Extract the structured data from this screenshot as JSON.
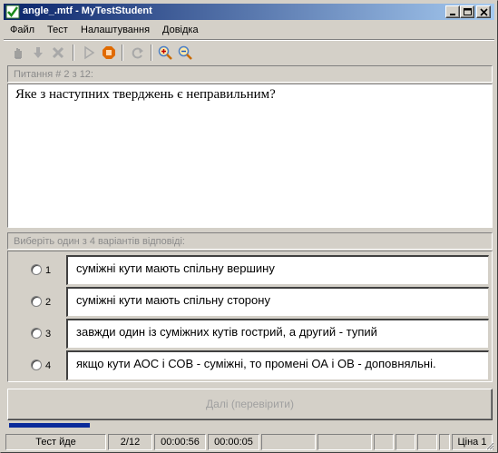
{
  "window": {
    "title": "angle_.mtf - MyTestStudent",
    "app_icon": "checkmark-icon"
  },
  "menu": [
    "Файл",
    "Тест",
    "Налаштування",
    "Довідка"
  ],
  "toolbar": {
    "icons": [
      "hand-icon",
      "arrow-down-icon",
      "close-x-icon",
      "play-icon",
      "stop-icon",
      "redo-icon",
      "zoom-in-icon",
      "zoom-out-icon"
    ],
    "accent": "#e06a00"
  },
  "question": {
    "header": "Питання # 2 з 12:",
    "text": "Яке з наступних тверджень є неправильним?"
  },
  "answers": {
    "header": "Виберіть один з 4 варіантів відповіді:",
    "options": [
      {
        "num": "1",
        "text": "суміжні кути мають спільну вершину"
      },
      {
        "num": "2",
        "text": "суміжні кути мають спільну сторону"
      },
      {
        "num": "3",
        "text": "завжди один із суміжних кутів гострий, а другий - тупий"
      },
      {
        "num": "4",
        "text": "якщо кути АОС і СОВ - суміжні, то промені ОА і ОВ - доповняльні."
      }
    ]
  },
  "next_button": "Далі (перевірити)",
  "progress": {
    "fraction": 0.1667,
    "color": "#0a2a9a"
  },
  "status": {
    "state": "Тест йде",
    "counter": "2/12",
    "elapsed": "00:00:56",
    "question_time": "00:00:05",
    "price": "Ціна 1"
  }
}
